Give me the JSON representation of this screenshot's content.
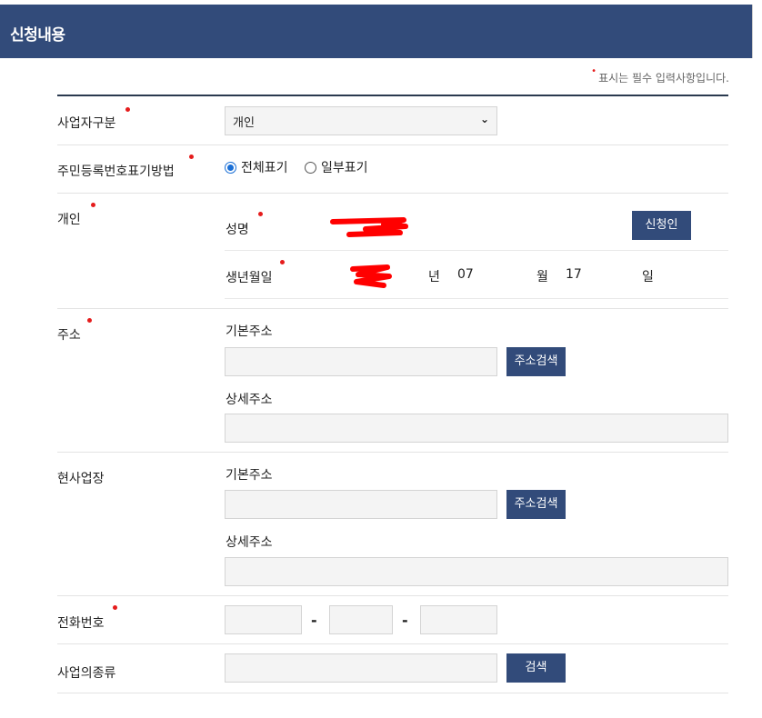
{
  "header": {
    "title": "신청내용"
  },
  "required_note": {
    "dot": "•",
    "text": "표시는 필수 입력사항입니다."
  },
  "rows": {
    "business_type": {
      "label": "사업자구분",
      "selected": "개인"
    },
    "rrn_display": {
      "label": "주민등록번호표기방법",
      "option_full": "전체표기",
      "option_partial": "일부표기",
      "selected": "전체표기"
    },
    "individual": {
      "label": "개인",
      "name_label": "성명",
      "applicant_button": "신청인",
      "birth_label": "생년월일",
      "year_suffix": "년",
      "month_value": "07",
      "month_suffix": "월",
      "day_value": "17",
      "day_suffix": "일"
    },
    "address": {
      "label": "주소",
      "basic_label": "기본주소",
      "search_button": "주소검색",
      "detail_label": "상세주소"
    },
    "workplace": {
      "label": "현사업장",
      "basic_label": "기본주소",
      "search_button": "주소검색",
      "detail_label": "상세주소"
    },
    "phone": {
      "label": "전화번호",
      "sep1": "-",
      "sep2": "-"
    },
    "business_kind": {
      "label": "사업의종류",
      "search_button": "검색"
    }
  },
  "colors": {
    "header_bg": "#324b7a",
    "required_dot": "#e51c1c",
    "radio_selected": "#1a6fd6"
  }
}
